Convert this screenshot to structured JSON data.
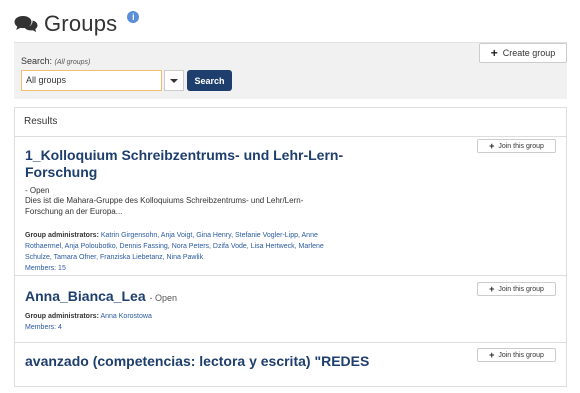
{
  "page": {
    "title": "Groups"
  },
  "search": {
    "label": "Search:",
    "hint": "(All groups)",
    "selected": "All groups",
    "button_label": "Search"
  },
  "create_button_label": "Create group",
  "results": {
    "header": "Results",
    "join_label": "Join this group",
    "groups": [
      {
        "title_line1": "1_Kolloquium Schreibzentrums- und Lehr-Lern-",
        "title_line2": "Forschung",
        "type": "- Open",
        "desc_line1": "Dies ist die Mahara-Gruppe des Kolloquiums Schreibzentrums- und Lehr/Lern-",
        "desc_line2": "Forschung an der Europa...",
        "admins_label": "Group administrators:",
        "admins_line1": "Katrin Girgensohn, Anja Voigt, Gina Henry, Stefanie Vogler-Lipp, Anne",
        "admins_line2": "Rothaermel, Anja Poloubotko, Dennis Fassing, Nora Peters, Dzifa Vode, Lisa Hertweck, Marlene",
        "admins_line3": "Schulze, Tamara Ofner, Franziska Liebetanz, Nina Pawlik",
        "members": "Members: 15"
      },
      {
        "title": "Anna_Bianca_Lea",
        "type": "- Open",
        "admins_label": "Group administrators:",
        "admins": "Anna Korostowa",
        "members": "Members: 4"
      },
      {
        "title": "avanzado (competencias: lectora y escrita) \"REDES"
      }
    ]
  }
}
